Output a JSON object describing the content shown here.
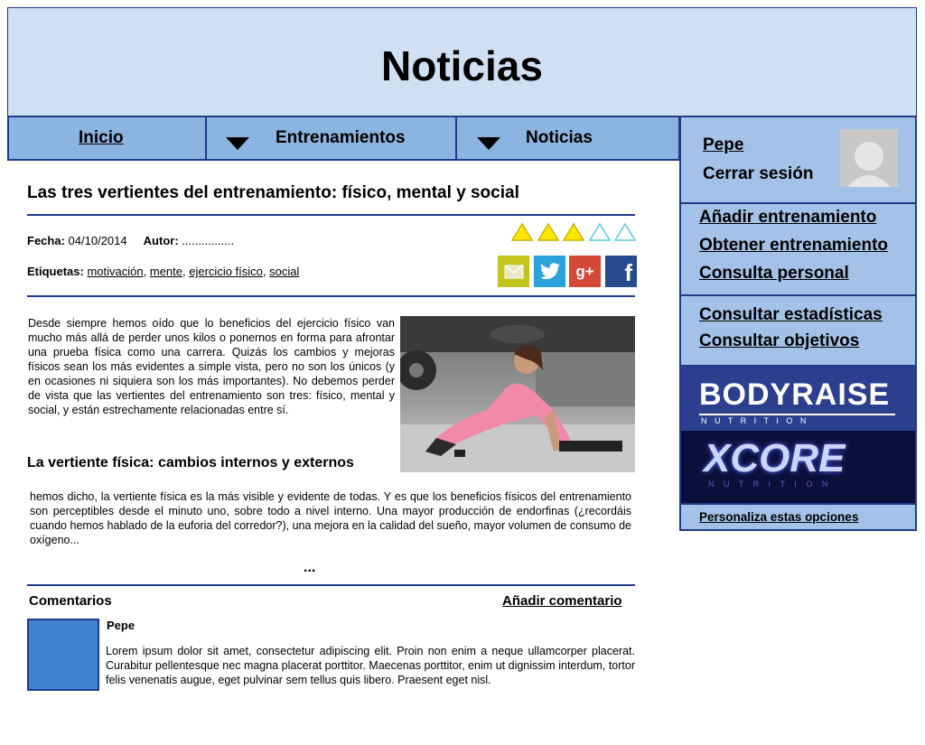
{
  "header": {
    "title": "Noticias"
  },
  "nav": {
    "items": [
      {
        "label": "Inicio"
      },
      {
        "label": "Entrenamientos"
      },
      {
        "label": "Noticias"
      }
    ]
  },
  "article": {
    "title": "Las tres vertientes del entrenamiento: físico, mental y social",
    "date_label": "Fecha:",
    "date_value": "04/10/2014",
    "author_label": "Autor:",
    "author_value": "................",
    "tags_label": "Etiquetas:",
    "tags": [
      "motivación",
      "mente",
      "ejercicio físico",
      "social"
    ],
    "tag_separator": ",",
    "rating": {
      "filled": 3,
      "total": 5,
      "filled_color": "#ffe600",
      "empty_color": "#5fc8d8"
    },
    "intro": "Desde siempre hemos oído que lo beneficios del ejercicio físico van mucho más allá de perder unos kilos o ponernos en forma para afrontar una prueba física como una carrera. Quizás los cambios y mejoras físicos sean los más evidentes a simple vista, pero no son los únicos (y en ocasiones ni siquiera son los más importantes). No debemos perder de vista que las vertientes del entrenamiento son tres: físico, mental y social, y están estrechamente relacionadas entre sí.",
    "subheading": "La vertiente física: cambios internos y externos",
    "body": " hemos dicho, la vertiente física es la más visible y evidente de todas. Y es que los beneficios físicos del entrenamiento son perceptibles desde el minuto uno, sobre todo a nivel interno. Una mayor producción de endorfinas (¿recordáis cuando hemos hablado de la euforia del corredor?), una mejora en la calidad del sueño, mayor volumen de consumo de oxígeno...",
    "ellipsis": "..."
  },
  "share": [
    {
      "icon": "mail-icon",
      "color": "#c2c61c"
    },
    {
      "icon": "twitter-icon",
      "color": "#2aa3dd"
    },
    {
      "icon": "google-plus-icon",
      "color": "#d34836"
    },
    {
      "icon": "facebook-icon",
      "color": "#274a8c"
    }
  ],
  "comments": {
    "label": "Comentarios",
    "add_label": "Añadir comentario",
    "items": [
      {
        "author": "Pepe",
        "text": " Lorem ipsum dolor sit amet, consectetur adipiscing elit. Proin non enim a neque ullamcorper placerat. Curabitur pellentesque nec magna placerat porttitor. Maecenas porttitor, enim ut dignissim interdum, tortor felis venenatis augue, eget pulvinar sem tellus quis libero. Praesent eget nisl."
      }
    ]
  },
  "sidebar": {
    "user_name": "Pepe",
    "logout": "Cerrar sesión",
    "group1": [
      "Añadir entrenamiento",
      "Obtener entrenamiento",
      "Consulta personal"
    ],
    "group2": [
      "Consultar estadísticas",
      "Consultar objetivos"
    ],
    "banner1": {
      "title": "BODYRAISE",
      "subtitle": "N U T R I T I O N"
    },
    "banner2": {
      "title": "XCORE",
      "subtitle": "N U T R I T I O N"
    },
    "customize": "Personaliza estas opciones"
  }
}
